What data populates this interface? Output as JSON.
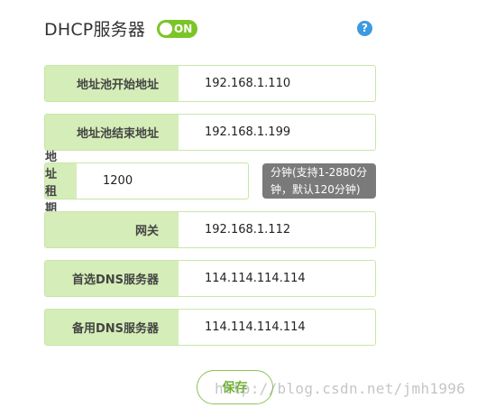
{
  "header": {
    "title": "DHCP服务器",
    "toggle_label": "ON",
    "toggle_state": "on",
    "help_label": "?"
  },
  "fields": [
    {
      "label": "地址池开始地址",
      "value": "192.168.1.110"
    },
    {
      "label": "地址池结束地址",
      "value": "192.168.1.199"
    },
    {
      "label": "地址租期",
      "value": "1200"
    },
    {
      "label": "网关",
      "value": "192.168.1.112"
    },
    {
      "label": "首选DNS服务器",
      "value": "114.114.114.114"
    },
    {
      "label": "备用DNS服务器",
      "value": "114.114.114.114"
    }
  ],
  "lease_tip": {
    "line1": "分钟(支持1-2880分",
    "line2": "钟，默认120分钟)"
  },
  "save_label": "保存",
  "watermark": "http://blog.csdn.net/jmh1996",
  "colors": {
    "accent_green": "#7cc528",
    "label_bg": "#d5edb8",
    "help_blue": "#3d9ae0",
    "tip_bg": "#7a7a7a"
  }
}
